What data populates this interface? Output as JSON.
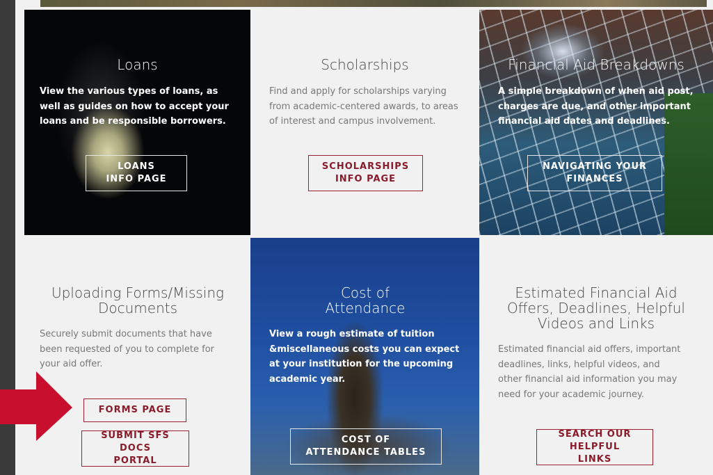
{
  "tiles": {
    "loans": {
      "title": "Loans",
      "desc": "View the various types of loans, as well as guides on how to accept your loans and be responsible borrowers.",
      "button": "LOANS INFO PAGE"
    },
    "scholarships": {
      "title": "Scholarships",
      "desc": "Find and apply for scholarships varying from academic-centered awards, to areas of interest and campus involvement.",
      "button": "SCHOLARSHIPS INFO PAGE"
    },
    "breakdowns": {
      "title": "Financial Aid Breakdowns",
      "desc": "A simple breakdown of when aid post, charges are due, and other important financial aid dates and deadlines.",
      "button": "NAVIGATING YOUR FINANCES"
    },
    "uploading": {
      "title": "Uploading Forms/Missing Documents",
      "desc": "Securely submit documents that have been requested of you to complete for your aid offer.",
      "button1": "FORMS PAGE",
      "button2": "SUBMIT SFS DOCS PORTAL"
    },
    "cost": {
      "title": "Cost of Attendance",
      "desc": "View a rough estimate of tuition &miscellaneous costs you can expect at your institution for the upcoming academic year.",
      "button": "COST OF ATTENDANCE TABLES"
    },
    "estimated": {
      "title": "Estimated Financial Aid Offers, Deadlines, Helpful Videos and Links",
      "desc": "Estimated financial aid offers, important deadlines, links, helpful videos, and other financial aid information you may need for your academic journey.",
      "button": "SEARCH OUR HELPFUL LINKS"
    }
  },
  "colors": {
    "accent": "#8a1b2b",
    "arrow": "#c8102e",
    "page_bg": "#f1f1f1"
  },
  "icons": {
    "pointer": "red-arrow-icon"
  }
}
